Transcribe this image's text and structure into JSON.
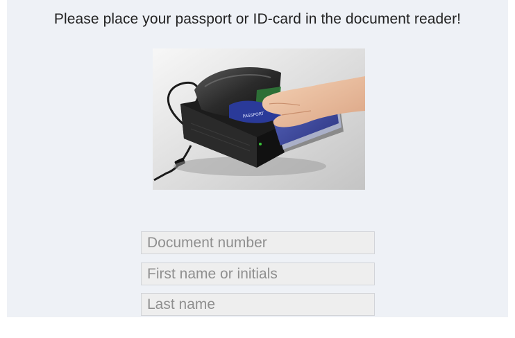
{
  "header": {
    "instruction": "Please place your passport or ID-card in the document reader!"
  },
  "illustration": {
    "icon": "passport-reader-illustration",
    "card_label": "PASSPORT"
  },
  "form": {
    "document_number": {
      "placeholder": "Document number",
      "value": ""
    },
    "first_name": {
      "placeholder": "First name or initials",
      "value": ""
    },
    "last_name": {
      "placeholder": "Last name",
      "value": ""
    }
  },
  "colors": {
    "panel_background": "#eef1f6",
    "field_background": "#eeeeee",
    "field_border": "#d2d4d8",
    "placeholder_text": "#8f8f8f",
    "text": "#222222"
  }
}
